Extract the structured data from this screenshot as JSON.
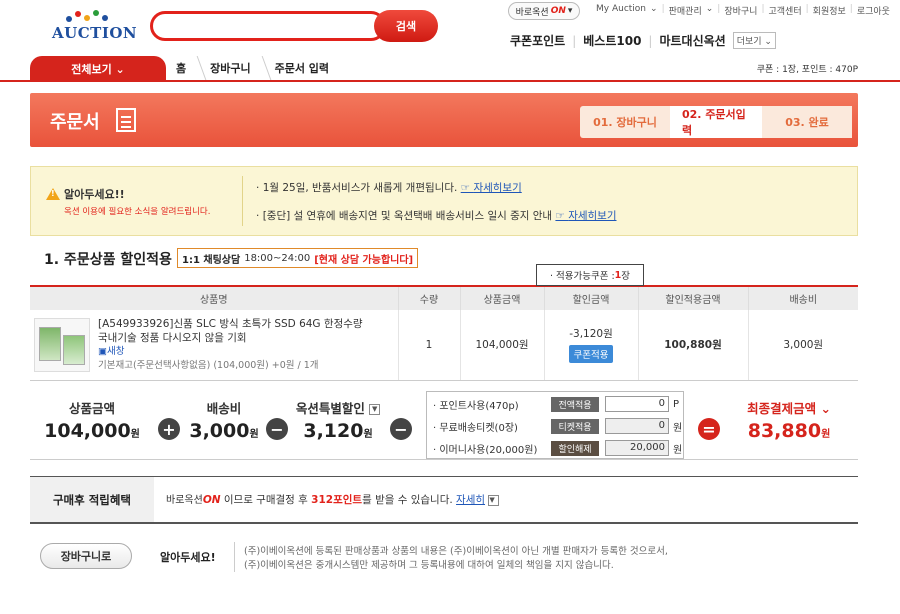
{
  "header": {
    "logo_text": "AUCTION",
    "search": {
      "value": "",
      "button_label": "검색"
    },
    "baro_toggle": {
      "label": "바로옥션",
      "state": "ON"
    },
    "top_links": [
      "My Auction",
      "판매관리",
      "장바구니",
      "고객센터",
      "회원정보",
      "로그아웃"
    ],
    "sub_nav": [
      "쿠폰포인트",
      "베스트100",
      "마트대신옥션"
    ],
    "more_label": "더보기"
  },
  "navbar": {
    "all_menu_label": "전체보기",
    "breadcrumb": [
      "홈",
      "장바구니",
      "주문서 입력"
    ],
    "coupon_info": "쿠폰 : 1장, 포인트 : 470P"
  },
  "banner": {
    "title": "주문서",
    "steps": [
      "01. 장바구니",
      "02. 주문서입력",
      "03. 완료"
    ]
  },
  "notice": {
    "heading": "알아두세요!!",
    "sub": "옥션 이용에 필요한 소식을 알려드립니다.",
    "lines": [
      {
        "text": "1월 25일, 반품서비스가 새롭게 개편됩니다.",
        "link": "자세히보기"
      },
      {
        "text": "[중단] 설 연휴에 배송지연 및 옥션택배 배송서비스 일시 중지 안내",
        "link": "자세히보기"
      }
    ]
  },
  "section1": {
    "title": "1. 주문상품 할인적용",
    "chat": {
      "label": "1:1 채팅상담",
      "hours": "18:00~24:00",
      "status": "[현재 상담 가능합니다]"
    },
    "tooltip": {
      "prefix": "· 적용가능쿠폰 : ",
      "count": "1",
      "suffix": "장"
    },
    "columns": [
      "상품명",
      "수량",
      "상품금액",
      "할인금액",
      "할인적용금액",
      "배송비"
    ],
    "row": {
      "name": "[A549933926]신품 SLC 방식 초특가 SSD 64G 한정수량 국내기술 정품 다시오지 않을 기회",
      "new_label": "새창",
      "stock": "기본재고(주문선택사항없음) (104,000원) +0원 / 1개",
      "qty": "1",
      "price": "104,000원",
      "discount": "-3,120원",
      "coupon_button": "쿠폰적용",
      "applied": "100,880원",
      "shipping": "3,000원"
    }
  },
  "totals": {
    "product": {
      "label": "상품금액",
      "value": "104,000",
      "unit": "원"
    },
    "shipping": {
      "label": "배송비",
      "value": "3,000",
      "unit": "원"
    },
    "special": {
      "label": "옥션특별할인",
      "value": "3,120",
      "unit": "원"
    },
    "payments": [
      {
        "label": "· 포인트사용(470p)",
        "button": "전액적용",
        "value": "0",
        "unit": "P"
      },
      {
        "label": "· 무료배송티켓(0장)",
        "button": "티켓적용",
        "value": "0",
        "unit": "원"
      },
      {
        "label": "· 이머니사용(20,000원)",
        "button": "할인해제",
        "value": "20,000",
        "unit": "원"
      }
    ],
    "final": {
      "label": "최종결제금액",
      "value": "83,880",
      "unit": "원"
    }
  },
  "points": {
    "heading": "구매후 적립혜택",
    "baro": "바로옥션",
    "on": "ON",
    "text1": " 이므로 구매결정 후 ",
    "amount": "312포인트",
    "text2": "를 받을 수 있습니다. ",
    "link": "자세히"
  },
  "footer": {
    "cart_button": "장바구니로",
    "heading": "알아두세요!",
    "lines": [
      "(주)이베이옥션에 등록된 판매상품과 상품의 내용은 (주)이베이옥션이 아닌 개별 판매자가 등록한 것으로서,",
      "(주)이베이옥션은 중개시스템만 제공하며 그 등록내용에 대하여 일체의 책임을 지지 않습니다."
    ]
  }
}
